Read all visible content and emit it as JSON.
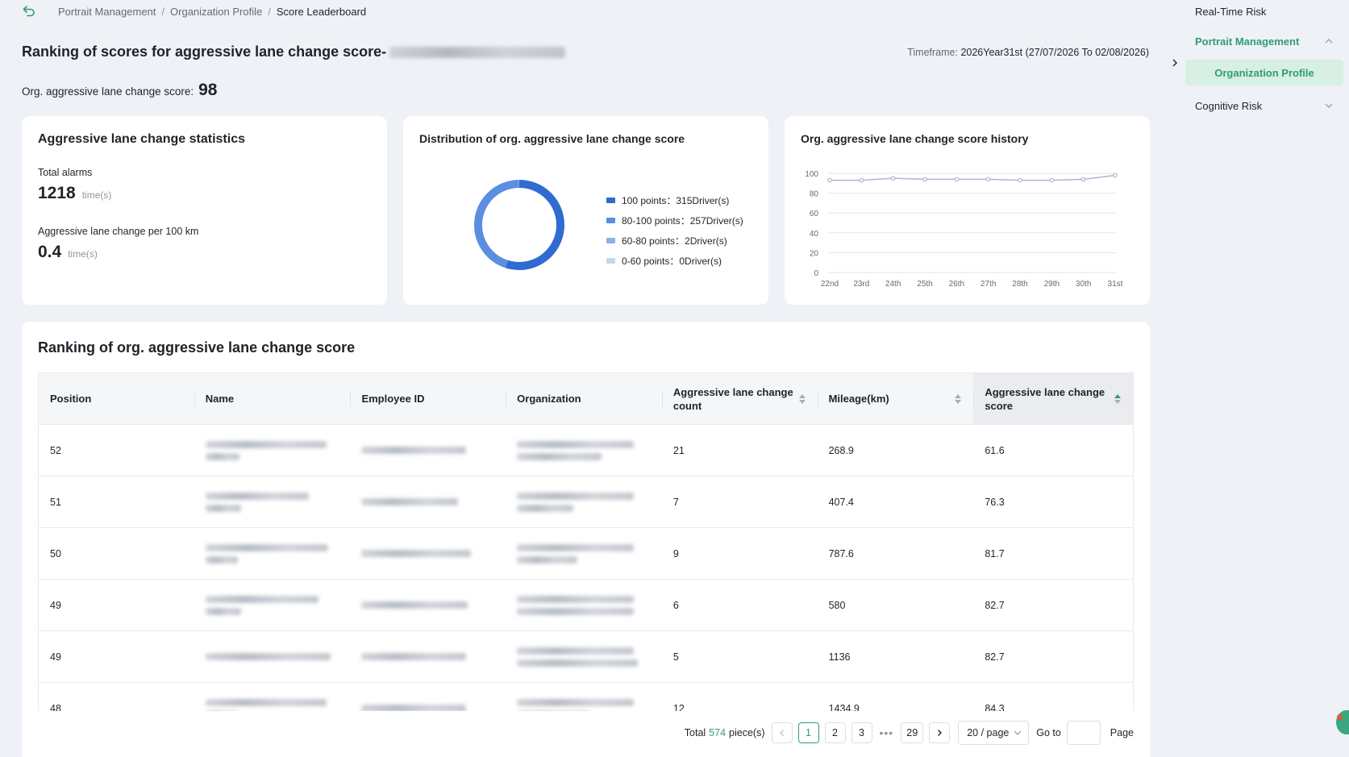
{
  "breadcrumb": [
    "Portrait Management",
    "Organization Profile",
    "Score Leaderboard"
  ],
  "page_title": "Ranking of scores for aggressive lane change score-",
  "timeframe": {
    "label": "Timeframe:",
    "value": "2026Year31st (27/07/2026 To 02/08/2026)"
  },
  "org_score": {
    "label": "Org. aggressive lane change score:",
    "value": "98"
  },
  "stats_card": {
    "title": "Aggressive lane change statistics",
    "total_alarms_label": "Total alarms",
    "total_alarms_value": "1218",
    "per_100km_label": "Aggressive lane change per 100 km",
    "per_100km_value": "0.4",
    "unit": "time(s)"
  },
  "distribution_card": {
    "title": "Distribution of org. aggressive lane change score",
    "legend": [
      {
        "label": "100 points：315Driver(s)",
        "color": "#2f6bd0"
      },
      {
        "label": "80-100 points：257Driver(s)",
        "color": "#5b8ee0"
      },
      {
        "label": "60-80 points：2Driver(s)",
        "color": "#8db0ea"
      },
      {
        "label": "0-60 points：0Driver(s)",
        "color": "#c4d7f4"
      }
    ],
    "chart_data": {
      "type": "pie",
      "categories": [
        "100 points",
        "80-100 points",
        "60-80 points",
        "0-60 points"
      ],
      "values": [
        315,
        257,
        2,
        0
      ]
    }
  },
  "history_card": {
    "title": "Org. aggressive lane change score history",
    "chart_data": {
      "type": "line",
      "x": [
        "22nd",
        "23rd",
        "24th",
        "25th",
        "26th",
        "27th",
        "28th",
        "29th",
        "30th",
        "31st"
      ],
      "series": [
        {
          "values": [
            93,
            93,
            95,
            94,
            94,
            94,
            93,
            93,
            94,
            98
          ]
        }
      ],
      "ylim": [
        0,
        100
      ],
      "yticks": [
        "0",
        "20",
        "40",
        "60",
        "80",
        "100"
      ],
      "color": "#a9b7cc",
      "grid": true
    }
  },
  "ranking": {
    "title": "Ranking of org. aggressive lane change score",
    "columns": [
      "Position",
      "Name",
      "Employee ID",
      "Organization",
      "Aggressive lane change count",
      "Mileage(km)",
      "Aggressive lane change score"
    ],
    "rows": [
      {
        "position": "52",
        "count": "21",
        "mileage": "268.9",
        "score": "61.6"
      },
      {
        "position": "51",
        "count": "7",
        "mileage": "407.4",
        "score": "76.3"
      },
      {
        "position": "50",
        "count": "9",
        "mileage": "787.6",
        "score": "81.7"
      },
      {
        "position": "49",
        "count": "6",
        "mileage": "580",
        "score": "82.7"
      },
      {
        "position": "49",
        "count": "5",
        "mileage": "1136",
        "score": "82.7"
      },
      {
        "position": "48",
        "count": "12",
        "mileage": "1434.9",
        "score": "84.3"
      }
    ]
  },
  "pagination": {
    "total_prefix": "Total",
    "total": "574",
    "total_suffix": "piece(s)",
    "pages": [
      "1",
      "2",
      "3",
      "29"
    ],
    "ellipsis": "•••",
    "page_size": "20 / page",
    "goto_label": "Go to",
    "page_label": "Page"
  },
  "sidebar": {
    "real_time": "Real-Time Risk",
    "portrait": "Portrait Management",
    "org_profile": "Organization Profile",
    "cognitive": "Cognitive Risk"
  },
  "colors": {
    "accent": "#2e9c77",
    "accent_light": "#d8efe4"
  }
}
